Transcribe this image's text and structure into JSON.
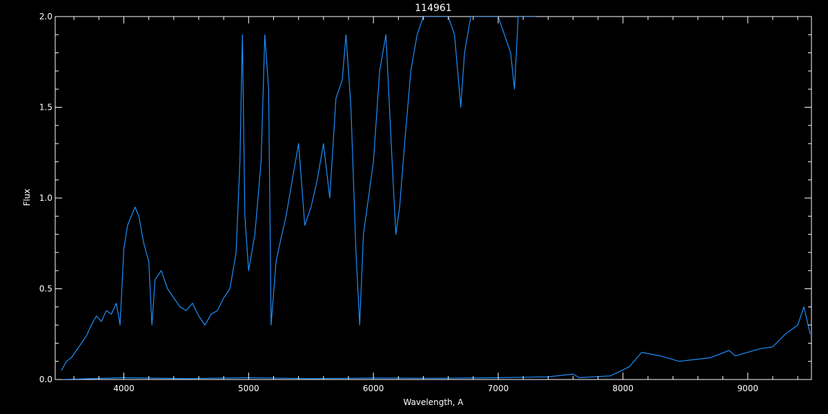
{
  "chart_data": {
    "type": "line",
    "title": "114961",
    "xlabel": "Wavelength, A",
    "ylabel": "Flux",
    "xlim": [
      3450,
      9510
    ],
    "ylim": [
      0,
      2.0
    ],
    "x_ticks": [
      4000,
      5000,
      6000,
      7000,
      8000,
      9000
    ],
    "x_tick_labels": [
      "4000",
      "5000",
      "6000",
      "7000",
      "8000",
      "9000"
    ],
    "y_ticks": [
      0.0,
      0.5,
      1.0,
      1.5,
      2.0
    ],
    "y_tick_labels": [
      "0.0",
      "0.5",
      "1.0",
      "1.5",
      "2.0"
    ],
    "grid": false,
    "legend": "none",
    "colors": {
      "background": "#000000",
      "axes": "#ffffff",
      "series": "#1e90ff"
    },
    "series": [
      {
        "values": [
          [
            3500,
            0.05
          ],
          [
            3540,
            0.1
          ],
          [
            3580,
            0.12
          ],
          [
            3620,
            0.16
          ],
          [
            3660,
            0.2
          ],
          [
            3700,
            0.24
          ],
          [
            3740,
            0.3
          ],
          [
            3780,
            0.35
          ],
          [
            3820,
            0.32
          ],
          [
            3860,
            0.38
          ],
          [
            3900,
            0.36
          ],
          [
            3940,
            0.42
          ],
          [
            3970,
            0.3
          ],
          [
            4000,
            0.72
          ],
          [
            4030,
            0.85
          ],
          [
            4060,
            0.9
          ],
          [
            4090,
            0.95
          ],
          [
            4120,
            0.9
          ],
          [
            4160,
            0.75
          ],
          [
            4200,
            0.65
          ],
          [
            4225,
            0.3
          ],
          [
            4250,
            0.55
          ],
          [
            4300,
            0.6
          ],
          [
            4350,
            0.5
          ],
          [
            4400,
            0.45
          ],
          [
            4450,
            0.4
          ],
          [
            4500,
            0.38
          ],
          [
            4550,
            0.42
          ],
          [
            4600,
            0.35
          ],
          [
            4650,
            0.3
          ],
          [
            4700,
            0.36
          ],
          [
            4750,
            0.38
          ],
          [
            4800,
            0.45
          ],
          [
            4850,
            0.5
          ],
          [
            4900,
            0.7
          ],
          [
            4930,
            1.2
          ],
          [
            4950,
            1.9
          ],
          [
            4970,
            0.9
          ],
          [
            5000,
            0.6
          ],
          [
            5050,
            0.8
          ],
          [
            5100,
            1.2
          ],
          [
            5130,
            1.9
          ],
          [
            5160,
            1.6
          ],
          [
            5180,
            0.3
          ],
          [
            5220,
            0.65
          ],
          [
            5260,
            0.78
          ],
          [
            5300,
            0.9
          ],
          [
            5350,
            1.1
          ],
          [
            5400,
            1.3
          ],
          [
            5450,
            0.85
          ],
          [
            5500,
            0.95
          ],
          [
            5550,
            1.1
          ],
          [
            5600,
            1.3
          ],
          [
            5650,
            1.0
          ],
          [
            5700,
            1.55
          ],
          [
            5750,
            1.65
          ],
          [
            5780,
            1.9
          ],
          [
            5820,
            1.5
          ],
          [
            5860,
            0.7
          ],
          [
            5890,
            0.3
          ],
          [
            5920,
            0.8
          ],
          [
            5960,
            1.0
          ],
          [
            6000,
            1.2
          ],
          [
            6050,
            1.7
          ],
          [
            6100,
            1.9
          ],
          [
            6150,
            1.2
          ],
          [
            6180,
            0.8
          ],
          [
            6210,
            0.95
          ],
          [
            6250,
            1.3
          ],
          [
            6300,
            1.7
          ],
          [
            6350,
            1.9
          ],
          [
            6400,
            2.0
          ],
          [
            6500,
            2.0
          ],
          [
            6600,
            2.0
          ],
          [
            6650,
            1.9
          ],
          [
            6700,
            1.5
          ],
          [
            6730,
            1.8
          ],
          [
            6780,
            2.0
          ],
          [
            6900,
            2.0
          ],
          [
            7000,
            2.0
          ],
          [
            7100,
            1.8
          ],
          [
            7130,
            1.6
          ],
          [
            7160,
            2.0
          ],
          [
            7300,
            2.0
          ]
        ]
      },
      {
        "values": [
          [
            3500,
            0.0
          ],
          [
            4000,
            0.01
          ],
          [
            4500,
            0.005
          ],
          [
            5000,
            0.01
          ],
          [
            5500,
            0.005
          ],
          [
            6000,
            0.008
          ],
          [
            6500,
            0.007
          ],
          [
            7000,
            0.01
          ],
          [
            7400,
            0.015
          ],
          [
            7600,
            0.03
          ],
          [
            7650,
            0.01
          ],
          [
            7900,
            0.02
          ],
          [
            8050,
            0.07
          ],
          [
            8150,
            0.15
          ],
          [
            8300,
            0.13
          ],
          [
            8450,
            0.1
          ],
          [
            8700,
            0.12
          ],
          [
            8850,
            0.16
          ],
          [
            8900,
            0.13
          ],
          [
            9100,
            0.17
          ],
          [
            9200,
            0.18
          ],
          [
            9300,
            0.25
          ],
          [
            9400,
            0.3
          ],
          [
            9450,
            0.4
          ],
          [
            9500,
            0.25
          ]
        ]
      }
    ]
  }
}
